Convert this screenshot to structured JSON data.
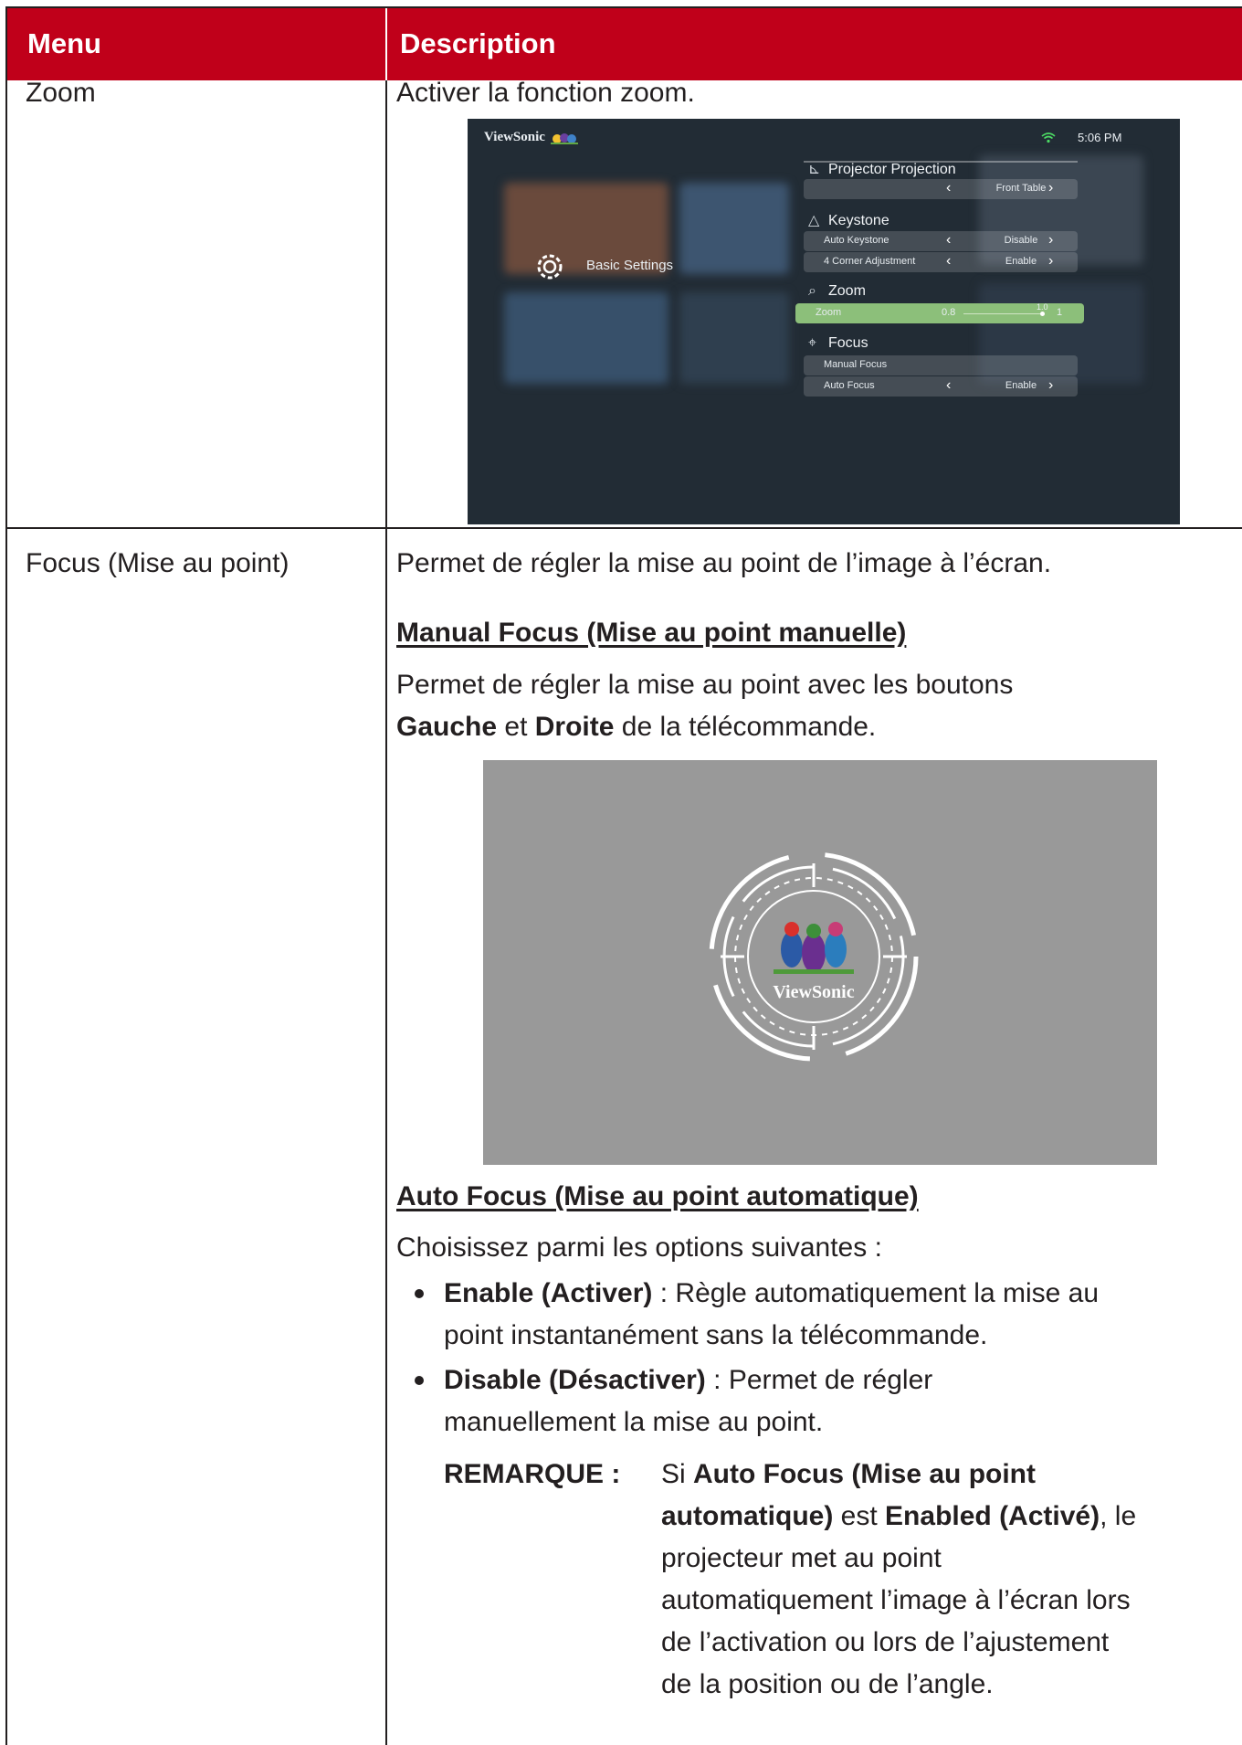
{
  "header": {
    "menu": "Menu",
    "description": "Description"
  },
  "zoom": {
    "menu": "Zoom",
    "description": "Activer la fonction zoom.",
    "screenshot": {
      "brand": "ViewSonic",
      "time": "5:06 PM",
      "panel_title": "Basic Settings",
      "sections": {
        "projection": "Projector Projection",
        "keystone": "Keystone",
        "zoom": "Zoom",
        "focus": "Focus"
      },
      "rows": {
        "projection_value": "Front Table",
        "auto_keystone_label": "Auto Keystone",
        "auto_keystone_value": "Disable",
        "corner_label": "4 Corner Adjustment",
        "corner_value": "Enable",
        "zoom_label": "Zoom",
        "zoom_value": "0.8",
        "zoom_knob_label": "1.0",
        "zoom_max": "1",
        "manual_focus_label": "Manual Focus",
        "auto_focus_label": "Auto Focus",
        "auto_focus_value": "Enable"
      },
      "colors": {
        "highlight": "#8cbf7a",
        "background": "#222c35"
      }
    }
  },
  "focus": {
    "menu": "Focus (Mise au point)",
    "intro": "Permet de régler la mise au point de l’image à l’écran.",
    "manual": {
      "heading": "Manual Focus (Mise au point manuelle)",
      "line1": "Permet de régler la mise au point avec les boutons",
      "left_btn": "Gauche",
      "and": " et ",
      "right_btn": "Droite",
      "tail": " de la télécommande."
    },
    "focus_pattern_logo": "ViewSonic",
    "auto": {
      "heading": "Auto Focus (Mise au point automatique)",
      "choose": "Choisissez parmi les options suivantes :",
      "enable_label": "Enable (Activer)",
      "enable_text": " : Règle automatiquement la mise au",
      "enable_text2": "point instantanément sans la télécommande.",
      "disable_label": "Disable (Désactiver)",
      "disable_text": " : Permet de régler",
      "disable_text2": "manuellement la mise au point.",
      "note_label": "REMARQUE :",
      "note_l1_a": "Si ",
      "note_l1_b": "Auto Focus (Mise au point",
      "note_l2_a": "automatique)",
      "note_l2_b": " est ",
      "note_l2_c": "Enabled (Activé)",
      "note_l2_d": ", le",
      "note_l3": "projecteur met au point",
      "note_l4": "automatiquement l’image à l’écran lors",
      "note_l5": "de l’activation ou lors de l’ajustement",
      "note_l6": "de la position ou de l’angle."
    }
  }
}
